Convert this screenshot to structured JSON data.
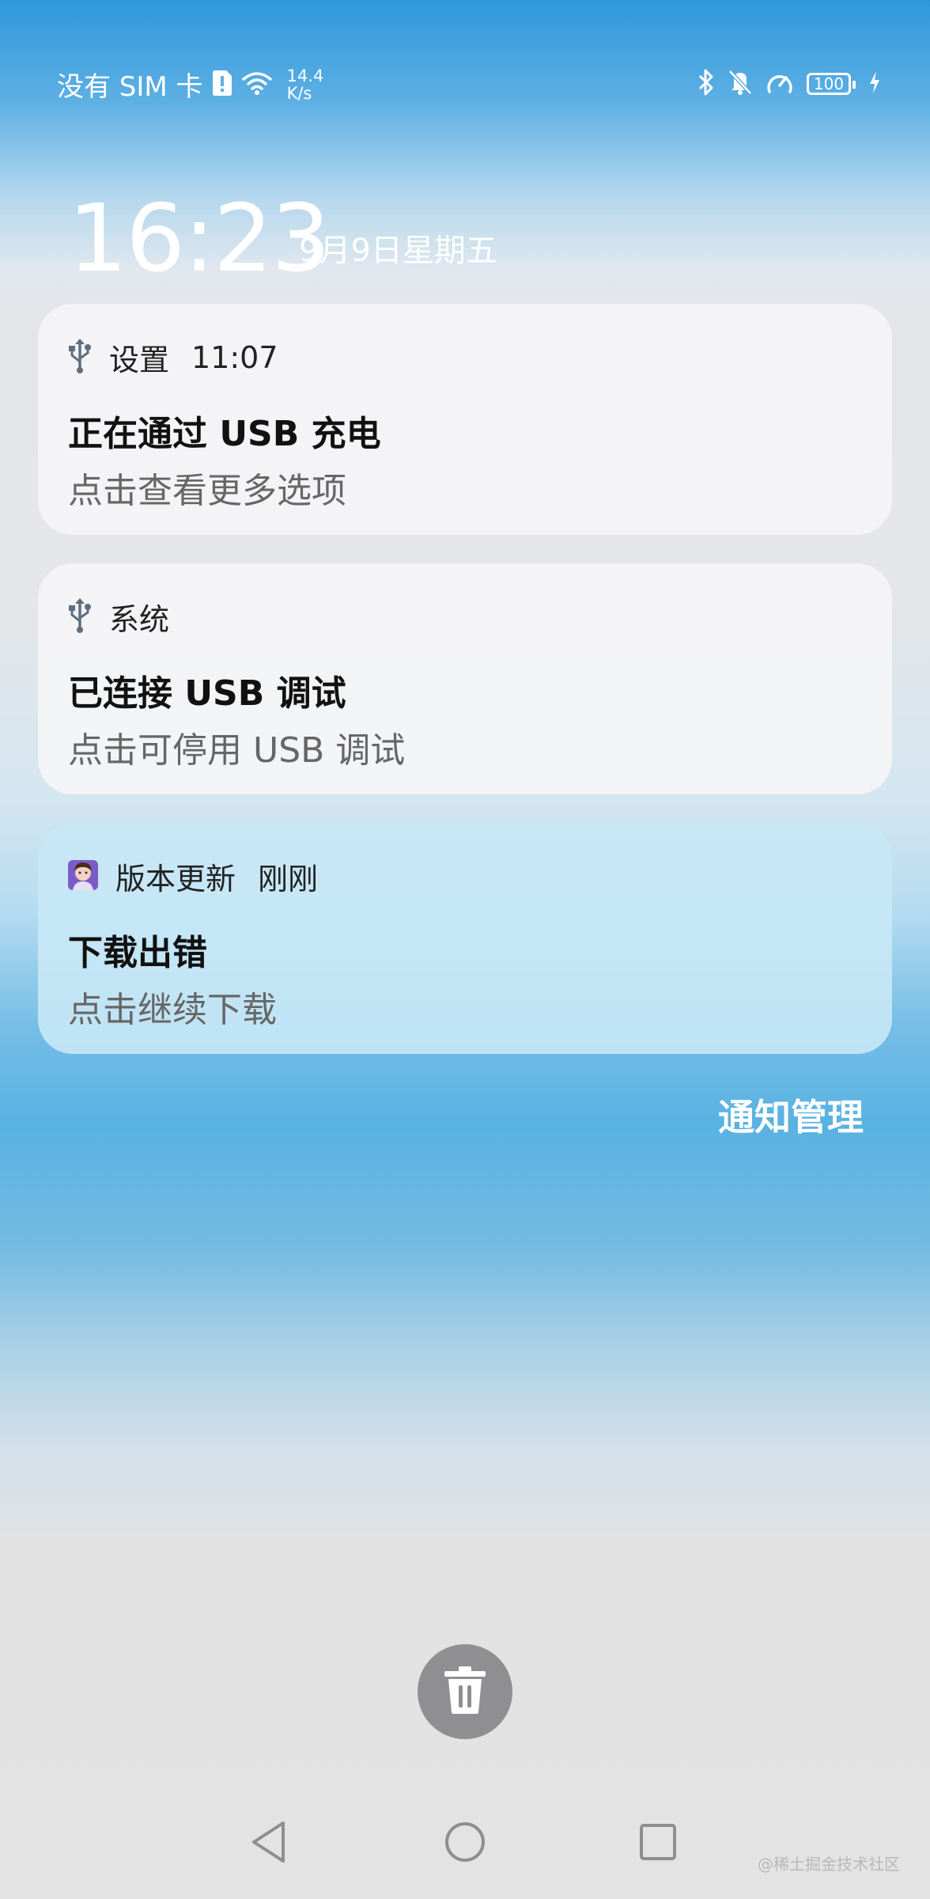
{
  "status_bar": {
    "sim_text": "没有 SIM 卡",
    "speed_value": "14.4",
    "speed_unit": "K/s",
    "battery": "100"
  },
  "lock": {
    "time": "16:23",
    "date": "9月9日星期五"
  },
  "notifications": [
    {
      "app": "设置",
      "time": "11:07",
      "title": "正在通过 USB 充电",
      "subtitle": "点击查看更多选项",
      "icon": "usb-icon"
    },
    {
      "app": "系统",
      "time": "",
      "title": "已连接 USB 调试",
      "subtitle": "点击可停用 USB 调试",
      "icon": "usb-icon"
    },
    {
      "app": "版本更新",
      "time": "刚刚",
      "title": "下载出错",
      "subtitle": "点击继续下载",
      "icon": "app-avatar-icon"
    }
  ],
  "manage_label": "通知管理",
  "watermark": "@稀土掘金技术社区",
  "colors": {
    "card": "#f4f4f6",
    "card_active": "#c8e8f6",
    "trash_button": "#8f8f91"
  }
}
